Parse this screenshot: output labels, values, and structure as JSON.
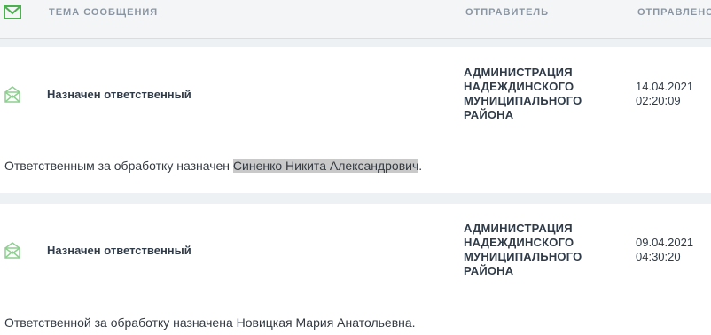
{
  "header": {
    "icon": "envelope-icon",
    "columns": {
      "subject": "ТЕМА СООБЩЕНИЯ",
      "sender": "ОТПРАВИТЕЛЬ",
      "sent": "ОТПРАВЛЕНО"
    }
  },
  "messages": [
    {
      "icon": "envelope-open-icon",
      "subject": "Назначен ответственный",
      "sender": "АДМИНИСТРАЦИЯ НАДЕЖДИНСКОГО МУНИЦИПАЛЬНОГО РАЙОНА",
      "date": "14.04.2021",
      "time": "02:20:09",
      "body_prefix": "Ответственным за обработку назначен ",
      "body_highlight": "Синенко Никита Александрович",
      "body_suffix": "."
    },
    {
      "icon": "envelope-open-icon",
      "subject": "Назначен ответственный",
      "sender": "АДМИНИСТРАЦИЯ НАДЕЖДИНСКОГО МУНИЦИПАЛЬНОГО РАЙОНА",
      "date": "09.04.2021",
      "time": "04:30:20",
      "body_prefix": "Ответственной за обработку назначена Новицкая Мария Анатольевна.",
      "body_highlight": "",
      "body_suffix": ""
    }
  ],
  "colors": {
    "accent_green": "#4caf50",
    "icon_light_green": "#8fcf91",
    "highlight": "#c9c9c9"
  }
}
